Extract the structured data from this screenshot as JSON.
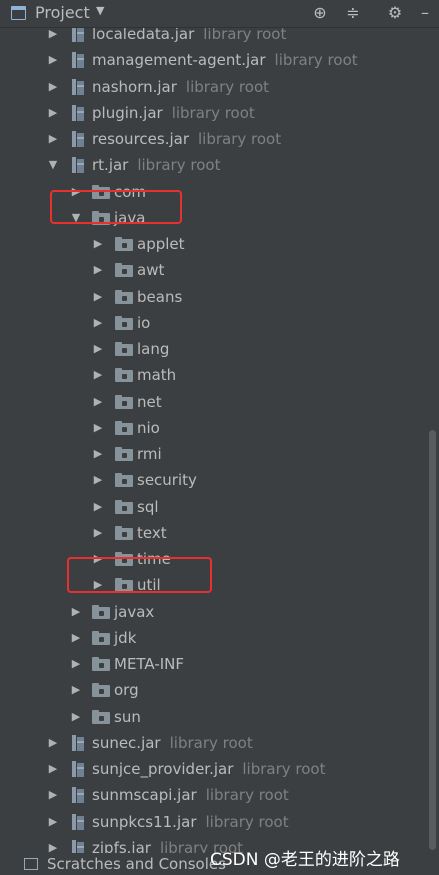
{
  "header": {
    "title": "Project",
    "dropdown_icon": "chevron-down-icon",
    "icons": [
      "locate-icon",
      "collapse-icon",
      "gear-icon",
      "minimize-icon"
    ]
  },
  "tree": {
    "suffix": "library root",
    "jars_top": [
      {
        "name": "localedata.jar",
        "suffix": "library root"
      },
      {
        "name": "management-agent.jar",
        "suffix": "library root"
      },
      {
        "name": "nashorn.jar",
        "suffix": "library root"
      },
      {
        "name": "plugin.jar",
        "suffix": "library root"
      },
      {
        "name": "resources.jar",
        "suffix": "library root"
      },
      {
        "name": "rt.jar",
        "suffix": "library root"
      }
    ],
    "rt_children": [
      "com",
      "java"
    ],
    "java_children": [
      "applet",
      "awt",
      "beans",
      "io",
      "lang",
      "math",
      "net",
      "nio",
      "rmi",
      "security",
      "sql",
      "text",
      "time",
      "util"
    ],
    "rt_children_after": [
      "javax",
      "jdk",
      "META-INF",
      "org",
      "sun"
    ],
    "jars_bottom": [
      {
        "name": "sunec.jar",
        "suffix": "library root"
      },
      {
        "name": "sunjce_provider.jar",
        "suffix": "library root"
      },
      {
        "name": "sunmscapi.jar",
        "suffix": "library root"
      },
      {
        "name": "sunpkcs11.jar",
        "suffix": "library root"
      },
      {
        "name": "zipfs.jar",
        "suffix": "library root"
      }
    ]
  },
  "footer": {
    "scratches_label": "Scratches and Consoles"
  },
  "watermark": "CSDN @老王的进阶之路",
  "colors": {
    "background": "#3c3f41",
    "highlight_box": "#e8312f",
    "text": "#bbbbbb",
    "suffix": "#808080"
  }
}
